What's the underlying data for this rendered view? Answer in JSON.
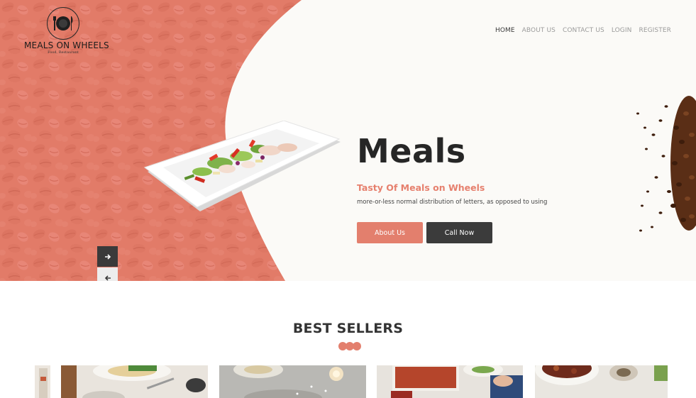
{
  "logo": {
    "title": "MEALS ON WHEELS",
    "subtitle": "Food, Restaurant",
    "icon": "plate-cutlery-icon"
  },
  "nav": {
    "items": [
      {
        "label": "HOME",
        "active": true
      },
      {
        "label": "ABOUT US",
        "active": false
      },
      {
        "label": "CONTACT US",
        "active": false
      },
      {
        "label": "LOGIN",
        "active": false
      },
      {
        "label": "REGISTER",
        "active": false
      }
    ]
  },
  "hero": {
    "headline": "Meals",
    "subheadline": "Tasty Of Meals on Wheels",
    "description": "more-or-less normal distribution of letters, as opposed to using",
    "about_button": "About Us",
    "call_button": "Call Now",
    "next_icon": "arrow-right-icon",
    "prev_icon": "arrow-left-icon"
  },
  "best_sellers": {
    "title": "BEST SELLERS"
  },
  "colors": {
    "accent": "#e37f6d",
    "dark": "#3b3b3b",
    "heading": "#262626",
    "hero_bg": "#fbfaf7"
  }
}
